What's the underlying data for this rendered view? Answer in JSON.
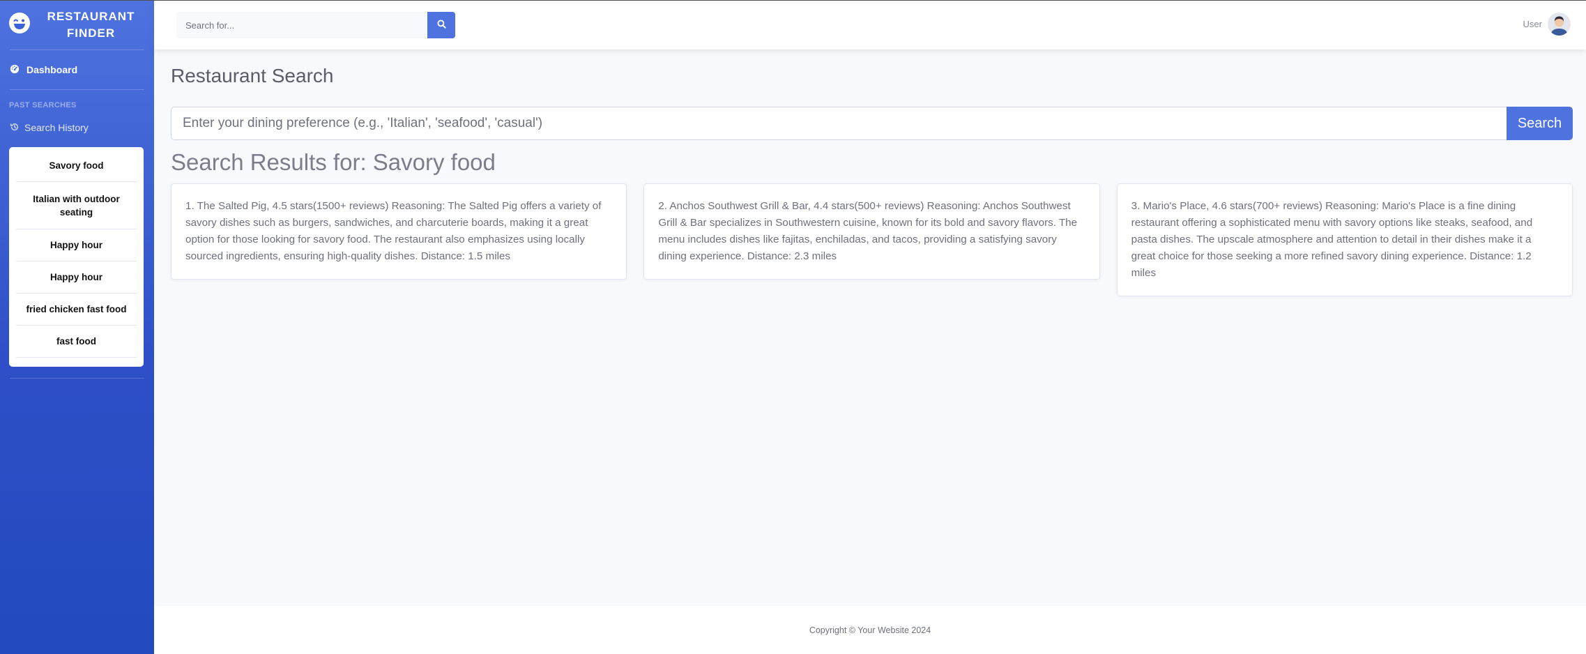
{
  "brand": {
    "line1": "RESTAURANT",
    "line2": "FINDER"
  },
  "sidebar": {
    "dashboard_label": "Dashboard",
    "heading": "PAST SEARCHES",
    "history_label": "Search History",
    "history_items": [
      "Savory food",
      "Italian with outdoor seating",
      "Happy hour",
      "Happy hour",
      "fried chicken fast food",
      "fast food"
    ]
  },
  "topbar": {
    "search_placeholder": "Search for...",
    "user_label": "User"
  },
  "main": {
    "title": "Restaurant Search",
    "query_placeholder": "Enter your dining preference (e.g., 'Italian', 'seafood', 'casual')",
    "search_button": "Search",
    "results_title": "Search Results for: Savory food",
    "results": [
      "1. The Salted Pig, 4.5 stars(1500+ reviews) Reasoning: The Salted Pig offers a variety of savory dishes such as burgers, sandwiches, and charcuterie boards, making it a great option for those looking for savory food. The restaurant also emphasizes using locally sourced ingredients, ensuring high-quality dishes. Distance: 1.5 miles",
      "2. Anchos Southwest Grill & Bar, 4.4 stars(500+ reviews) Reasoning: Anchos Southwest Grill & Bar specializes in Southwestern cuisine, known for its bold and savory flavors. The menu includes dishes like fajitas, enchiladas, and tacos, providing a satisfying savory dining experience. Distance: 2.3 miles",
      "3. Mario's Place, 4.6 stars(700+ reviews) Reasoning: Mario's Place is a fine dining restaurant offering a sophisticated menu with savory options like steaks, seafood, and pasta dishes. The upscale atmosphere and attention to detail in their dishes make it a great choice for those seeking a more refined savory dining experience. Distance: 1.2 miles"
    ]
  },
  "footer": {
    "copyright": "Copyright © Your Website 2024"
  },
  "colors": {
    "primary": "#4e73df",
    "sidebar_dark": "#224abe",
    "background": "#f8f9fc"
  },
  "icons": [
    "laugh-wink-icon",
    "dashboard-gauge-icon",
    "history-icon",
    "search-icon",
    "user-avatar"
  ]
}
